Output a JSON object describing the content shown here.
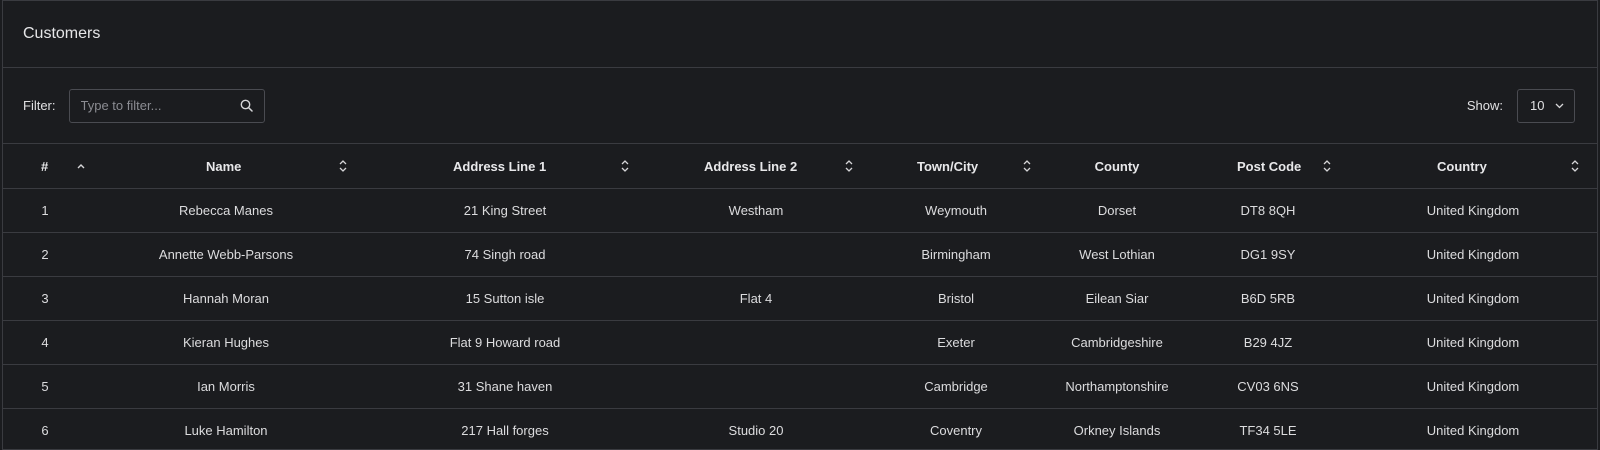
{
  "panel": {
    "title": "Customers"
  },
  "toolbar": {
    "filter_label": "Filter:",
    "filter_placeholder": "Type to filter...",
    "filter_value": "",
    "show_label": "Show:",
    "show_value": "10"
  },
  "table": {
    "columns": [
      "#",
      "Name",
      "Address Line 1",
      "Address Line 2",
      "Town/City",
      "County",
      "Post Code",
      "Country"
    ],
    "rows": [
      [
        "1",
        "Rebecca Manes",
        "21 King Street",
        "Westham",
        "Weymouth",
        "Dorset",
        "DT8 8QH",
        "United Kingdom"
      ],
      [
        "2",
        "Annette Webb-Parsons",
        "74 Singh road",
        "",
        "Birmingham",
        "West Lothian",
        "DG1 9SY",
        "United Kingdom"
      ],
      [
        "3",
        "Hannah Moran",
        "15 Sutton isle",
        "Flat 4",
        "Bristol",
        "Eilean Siar",
        "B6D 5RB",
        "United Kingdom"
      ],
      [
        "4",
        "Kieran Hughes",
        "Flat 9 Howard road",
        "",
        "Exeter",
        "Cambridgeshire",
        "B29 4JZ",
        "United Kingdom"
      ],
      [
        "5",
        "Ian Morris",
        "31 Shane haven",
        "",
        "Cambridge",
        "Northamptonshire",
        "CV03 6NS",
        "United Kingdom"
      ],
      [
        "6",
        "Luke Hamilton",
        "217 Hall forges",
        "Studio 20",
        "Coventry",
        "Orkney Islands",
        "TF34 5LE",
        "United Kingdom"
      ]
    ]
  },
  "icons": {
    "search": "search-icon",
    "select_chevron": "chevron-down-icon",
    "sort_ascending": "sort-ascending-icon",
    "sort_both": "sort-icon"
  },
  "colors": {
    "background": "#1b1c1f",
    "border": "#3a3b40",
    "text": "#e4e4e6",
    "muted": "#8b8c92"
  }
}
